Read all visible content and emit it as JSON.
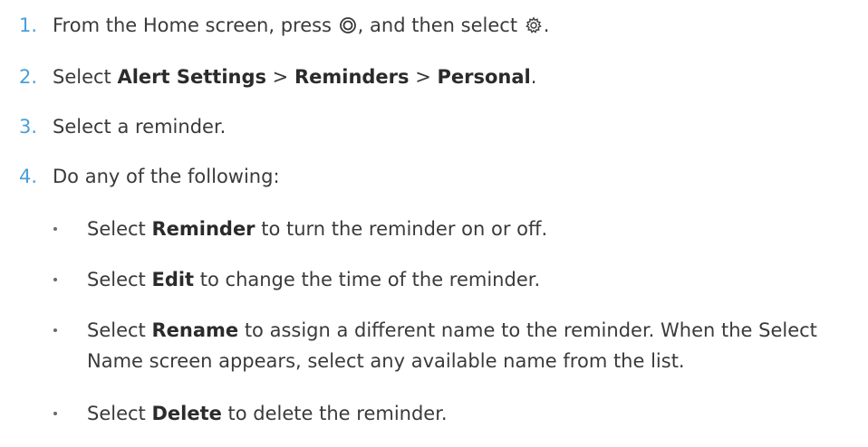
{
  "steps": [
    {
      "number": "1.",
      "parts": [
        "From the Home screen, press ",
        ", and then select ",
        "."
      ],
      "icons": [
        "menu-button-icon",
        "gear-icon"
      ]
    },
    {
      "number": "2.",
      "prefix": "Select ",
      "item1": "Alert Settings",
      "sep1": " > ",
      "item2": "Reminders",
      "sep2": " > ",
      "item3": "Personal",
      "suffix": "."
    },
    {
      "number": "3.",
      "text": "Select a reminder."
    },
    {
      "number": "4.",
      "text": "Do any of the following:"
    }
  ],
  "bullets": [
    {
      "prefix": "Select ",
      "bold": "Reminder",
      "rest": " to turn the reminder on or off."
    },
    {
      "prefix": "Select ",
      "bold": "Edit",
      "rest": " to change the time of the reminder."
    },
    {
      "prefix": "Select ",
      "bold": "Rename",
      "rest": " to assign a different name to the reminder. When the Select",
      "rest2": "Name screen appears, select any available name from the list."
    },
    {
      "prefix": "Select ",
      "bold": "Delete",
      "rest": " to delete the reminder."
    }
  ],
  "colors": {
    "number": "#4a9fd8",
    "text": "#3a3a3a"
  }
}
